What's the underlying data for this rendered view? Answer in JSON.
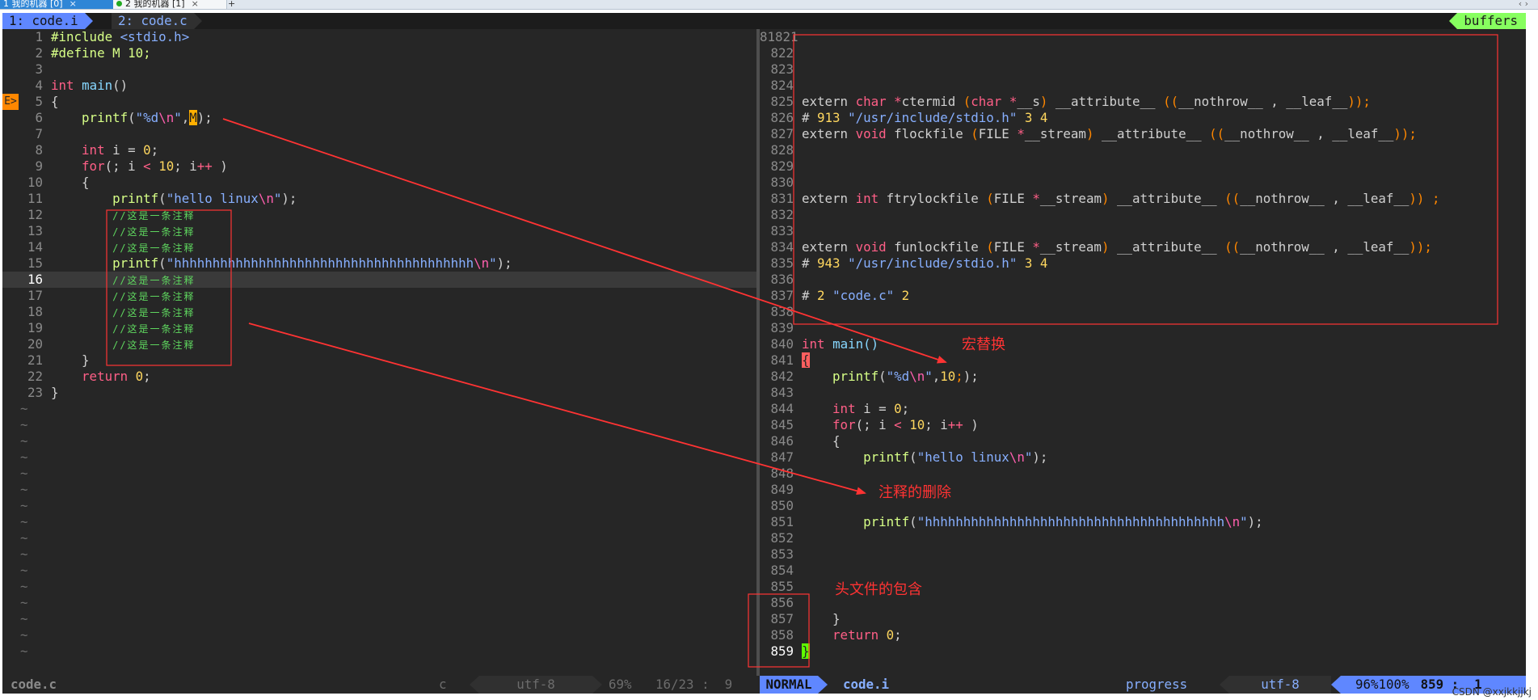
{
  "terminal_tabs": [
    {
      "label": "1 我的机器 [0]",
      "close": "×"
    },
    {
      "label": "2 我的机器 [1]",
      "close": "×"
    }
  ],
  "add_tab": "+",
  "window_buttons": "‹ ›",
  "vim": {
    "tabline": {
      "tab1": "1: code.i",
      "tab2": "2: code.c",
      "buffers": "buffers"
    },
    "sign_text": "E>",
    "left_lines": [
      {
        "n": "1",
        "tokens": [
          [
            "pp",
            "#include "
          ],
          [
            "st",
            "<stdio.h>"
          ]
        ]
      },
      {
        "n": "2",
        "tokens": [
          [
            "pp",
            "#define M 10;"
          ]
        ]
      },
      {
        "n": "3",
        "tokens": []
      },
      {
        "n": "4",
        "tokens": [
          [
            "kw",
            "int"
          ],
          [
            "pl",
            " "
          ],
          [
            "fn",
            "main"
          ],
          [
            "pl",
            "()"
          ]
        ]
      },
      {
        "n": "5",
        "tokens": [
          [
            "pl",
            "{"
          ]
        ]
      },
      {
        "n": "6",
        "tokens": [
          [
            "pl",
            "    "
          ],
          [
            "pp",
            "printf"
          ],
          [
            "pl",
            "("
          ],
          [
            "st",
            "\"%d"
          ],
          [
            "sp",
            "\\n"
          ],
          [
            "st",
            "\""
          ],
          [
            "pl",
            ","
          ],
          [
            "cursor-M",
            "M"
          ],
          [
            "pl",
            ");"
          ]
        ]
      },
      {
        "n": "7",
        "tokens": []
      },
      {
        "n": "8",
        "tokens": [
          [
            "pl",
            "    "
          ],
          [
            "kw",
            "int"
          ],
          [
            "pl",
            " i = "
          ],
          [
            "nu",
            "0"
          ],
          [
            "pl",
            ";"
          ]
        ]
      },
      {
        "n": "9",
        "tokens": [
          [
            "pl",
            "    "
          ],
          [
            "kw",
            "for"
          ],
          [
            "pl",
            "(; i "
          ],
          [
            "kw",
            "<"
          ],
          [
            "pl",
            " "
          ],
          [
            "nu",
            "10"
          ],
          [
            "pl",
            "; i"
          ],
          [
            "kw",
            "++"
          ],
          [
            "pl",
            " )"
          ]
        ]
      },
      {
        "n": "10",
        "tokens": [
          [
            "pl",
            "    {"
          ]
        ]
      },
      {
        "n": "11",
        "tokens": [
          [
            "pl",
            "        "
          ],
          [
            "pp",
            "printf"
          ],
          [
            "pl",
            "("
          ],
          [
            "st",
            "\"hello linux"
          ],
          [
            "sp",
            "\\n"
          ],
          [
            "st",
            "\""
          ],
          [
            "pl",
            ");"
          ]
        ]
      },
      {
        "n": "12",
        "tokens": [
          [
            "pl",
            "        "
          ],
          [
            "cm",
            "//这是一条注释"
          ]
        ]
      },
      {
        "n": "13",
        "tokens": [
          [
            "pl",
            "        "
          ],
          [
            "cm",
            "//这是一条注释"
          ]
        ]
      },
      {
        "n": "14",
        "tokens": [
          [
            "pl",
            "        "
          ],
          [
            "cm",
            "//这是一条注释"
          ]
        ]
      },
      {
        "n": "15",
        "tokens": [
          [
            "pl",
            "        "
          ],
          [
            "pp",
            "printf"
          ],
          [
            "pl",
            "("
          ],
          [
            "st",
            "\"hhhhhhhhhhhhhhhhhhhhhhhhhhhhhhhhhhhhhhh"
          ],
          [
            "sp",
            "\\n"
          ],
          [
            "st",
            "\""
          ],
          [
            "pl",
            ");"
          ]
        ]
      },
      {
        "n": "16",
        "tokens": [
          [
            "pl",
            "        "
          ],
          [
            "cm",
            "//这是一条注释"
          ]
        ],
        "current": true
      },
      {
        "n": "17",
        "tokens": [
          [
            "pl",
            "        "
          ],
          [
            "cm",
            "//这是一条注释"
          ]
        ]
      },
      {
        "n": "18",
        "tokens": [
          [
            "pl",
            "        "
          ],
          [
            "cm",
            "//这是一条注释"
          ]
        ]
      },
      {
        "n": "19",
        "tokens": [
          [
            "pl",
            "        "
          ],
          [
            "cm",
            "//这是一条注释"
          ]
        ]
      },
      {
        "n": "20",
        "tokens": [
          [
            "pl",
            "        "
          ],
          [
            "cm",
            "//这是一条注释"
          ]
        ]
      },
      {
        "n": "21",
        "tokens": [
          [
            "pl",
            "    }"
          ]
        ]
      },
      {
        "n": "22",
        "tokens": [
          [
            "pl",
            "    "
          ],
          [
            "kw",
            "return"
          ],
          [
            "pl",
            " "
          ],
          [
            "nu",
            "0"
          ],
          [
            "pl",
            ";"
          ]
        ]
      },
      {
        "n": "23",
        "tokens": [
          [
            "pl",
            "}"
          ]
        ]
      }
    ],
    "tilde_count": 16,
    "right_lines": [
      {
        "n": "81821",
        "tokens": []
      },
      {
        "n": "822",
        "tokens": []
      },
      {
        "n": "823",
        "tokens": []
      },
      {
        "n": "824",
        "tokens": []
      },
      {
        "n": "825",
        "tokens": [
          [
            "pl",
            "extern "
          ],
          [
            "kw",
            "char"
          ],
          [
            "pl",
            " "
          ],
          [
            "kw",
            "*"
          ],
          [
            "pl",
            "ctermid "
          ],
          [
            "op",
            "("
          ],
          [
            "kw",
            "char"
          ],
          [
            "pl",
            " "
          ],
          [
            "kw",
            "*"
          ],
          [
            "pl",
            "__s"
          ],
          [
            "op",
            ")"
          ],
          [
            "pl",
            " __attribute__ "
          ],
          [
            "op",
            "(("
          ],
          [
            "pl",
            "__nothrow__ , __leaf__"
          ],
          [
            "op",
            "));"
          ]
        ]
      },
      {
        "n": "826",
        "tokens": [
          [
            "pl",
            "# "
          ],
          [
            "nu",
            "913"
          ],
          [
            "pl",
            " "
          ],
          [
            "st",
            "\"/usr/include/stdio.h\""
          ],
          [
            "pl",
            " "
          ],
          [
            "nu",
            "3"
          ],
          [
            "pl",
            " "
          ],
          [
            "nu",
            "4"
          ]
        ]
      },
      {
        "n": "827",
        "tokens": [
          [
            "pl",
            "extern "
          ],
          [
            "kw",
            "void"
          ],
          [
            "pl",
            " flockfile "
          ],
          [
            "op",
            "("
          ],
          [
            "pl",
            "FILE "
          ],
          [
            "kw",
            "*"
          ],
          [
            "pl",
            "__stream"
          ],
          [
            "op",
            ")"
          ],
          [
            "pl",
            " __attribute__ "
          ],
          [
            "op",
            "(("
          ],
          [
            "pl",
            "__nothrow__ , __leaf__"
          ],
          [
            "op",
            "));"
          ]
        ]
      },
      {
        "n": "828",
        "tokens": []
      },
      {
        "n": "829",
        "tokens": []
      },
      {
        "n": "830",
        "tokens": []
      },
      {
        "n": "831",
        "tokens": [
          [
            "pl",
            "extern "
          ],
          [
            "kw",
            "int"
          ],
          [
            "pl",
            " ftrylockfile "
          ],
          [
            "op",
            "("
          ],
          [
            "pl",
            "FILE "
          ],
          [
            "kw",
            "*"
          ],
          [
            "pl",
            "__stream"
          ],
          [
            "op",
            ")"
          ],
          [
            "pl",
            " __attribute__ "
          ],
          [
            "op",
            "(("
          ],
          [
            "pl",
            "__nothrow__ , __leaf__"
          ],
          [
            "op",
            ")) ;"
          ]
        ]
      },
      {
        "n": "832",
        "tokens": []
      },
      {
        "n": "833",
        "tokens": []
      },
      {
        "n": "834",
        "tokens": [
          [
            "pl",
            "extern "
          ],
          [
            "kw",
            "void"
          ],
          [
            "pl",
            " funlockfile "
          ],
          [
            "op",
            "("
          ],
          [
            "pl",
            "FILE "
          ],
          [
            "kw",
            "*"
          ],
          [
            "pl",
            "__stream"
          ],
          [
            "op",
            ")"
          ],
          [
            "pl",
            " __attribute__ "
          ],
          [
            "op",
            "(("
          ],
          [
            "pl",
            "__nothrow__ , __leaf__"
          ],
          [
            "op",
            "));"
          ]
        ]
      },
      {
        "n": "835",
        "tokens": [
          [
            "pl",
            "# "
          ],
          [
            "nu",
            "943"
          ],
          [
            "pl",
            " "
          ],
          [
            "st",
            "\"/usr/include/stdio.h\""
          ],
          [
            "pl",
            " "
          ],
          [
            "nu",
            "3"
          ],
          [
            "pl",
            " "
          ],
          [
            "nu",
            "4"
          ]
        ]
      },
      {
        "n": "836",
        "tokens": []
      },
      {
        "n": "837",
        "tokens": [
          [
            "pl",
            "# "
          ],
          [
            "nu",
            "2"
          ],
          [
            "pl",
            " "
          ],
          [
            "st",
            "\"code.c\""
          ],
          [
            "pl",
            " "
          ],
          [
            "nu",
            "2"
          ]
        ]
      },
      {
        "n": "838",
        "tokens": []
      },
      {
        "n": "839",
        "tokens": []
      },
      {
        "n": "840",
        "tokens": [
          [
            "kw",
            "int"
          ],
          [
            "pl",
            " "
          ],
          [
            "fn",
            "main"
          ],
          [
            "fn",
            "()"
          ]
        ]
      },
      {
        "n": "841",
        "tokens": [
          [
            "cursor-br",
            "{"
          ]
        ]
      },
      {
        "n": "842",
        "tokens": [
          [
            "pl",
            "    "
          ],
          [
            "pp",
            "printf"
          ],
          [
            "pl",
            "("
          ],
          [
            "st",
            "\"%d"
          ],
          [
            "sp",
            "\\n"
          ],
          [
            "st",
            "\""
          ],
          [
            "pl",
            ","
          ],
          [
            "nu",
            "10"
          ],
          [
            "op",
            ";"
          ],
          [
            "pl",
            ");"
          ]
        ]
      },
      {
        "n": "843",
        "tokens": []
      },
      {
        "n": "844",
        "tokens": [
          [
            "pl",
            "    "
          ],
          [
            "kw",
            "int"
          ],
          [
            "pl",
            " i = "
          ],
          [
            "nu",
            "0"
          ],
          [
            "pl",
            ";"
          ]
        ]
      },
      {
        "n": "845",
        "tokens": [
          [
            "pl",
            "    "
          ],
          [
            "kw",
            "for"
          ],
          [
            "pl",
            "(; i "
          ],
          [
            "kw",
            "<"
          ],
          [
            "pl",
            " "
          ],
          [
            "nu",
            "10"
          ],
          [
            "pl",
            "; i"
          ],
          [
            "kw",
            "++"
          ],
          [
            "pl",
            " )"
          ]
        ]
      },
      {
        "n": "846",
        "tokens": [
          [
            "pl",
            "    {"
          ]
        ]
      },
      {
        "n": "847",
        "tokens": [
          [
            "pl",
            "        "
          ],
          [
            "pp",
            "printf"
          ],
          [
            "pl",
            "("
          ],
          [
            "st",
            "\"hello linux"
          ],
          [
            "sp",
            "\\n"
          ],
          [
            "st",
            "\""
          ],
          [
            "pl",
            ");"
          ]
        ]
      },
      {
        "n": "848",
        "tokens": []
      },
      {
        "n": "849",
        "tokens": []
      },
      {
        "n": "850",
        "tokens": []
      },
      {
        "n": "851",
        "tokens": [
          [
            "pl",
            "        "
          ],
          [
            "pp",
            "printf"
          ],
          [
            "pl",
            "("
          ],
          [
            "st",
            "\"hhhhhhhhhhhhhhhhhhhhhhhhhhhhhhhhhhhhhhh"
          ],
          [
            "sp",
            "\\n"
          ],
          [
            "st",
            "\""
          ],
          [
            "pl",
            ");"
          ]
        ]
      },
      {
        "n": "852",
        "tokens": []
      },
      {
        "n": "853",
        "tokens": []
      },
      {
        "n": "854",
        "tokens": []
      },
      {
        "n": "855",
        "tokens": []
      },
      {
        "n": "856",
        "tokens": []
      },
      {
        "n": "857",
        "tokens": [
          [
            "pl",
            "    }"
          ]
        ]
      },
      {
        "n": "858",
        "tokens": [
          [
            "pl",
            "    "
          ],
          [
            "kw",
            "return"
          ],
          [
            "pl",
            " "
          ],
          [
            "nu",
            "0"
          ],
          [
            "pl",
            ";"
          ]
        ]
      },
      {
        "n": "859",
        "tokens": [
          [
            "cursor-g",
            "}"
          ]
        ],
        "current_nr": true
      }
    ],
    "status": {
      "left_file": "code.c",
      "left_filetype": "c",
      "left_encoding": "utf-8",
      "left_percent": "69%",
      "left_position": "16/23 :  9",
      "mode": "NORMAL",
      "right_file": "code.i",
      "right_progress": "progress",
      "right_encoding": "utf-8",
      "right_percent": "96%100%",
      "right_position": "859 :  1"
    }
  },
  "annotations": {
    "macro": "宏替换",
    "comment": "注释的删除",
    "header": "头文件的包含",
    "color": "#ff3333"
  },
  "watermark": "CSDN @xxjkkjjkj"
}
